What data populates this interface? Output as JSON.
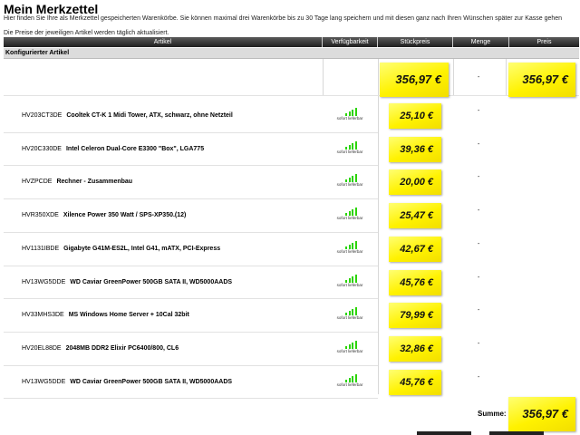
{
  "page": {
    "title": "Mein Merkzettel",
    "intro": "Hier finden Sie Ihre als Merkzettel gespeicherten Warenkörbe. Sie können maximal drei Warenkörbe bis zu 30 Tage lang speichern und mit diesen ganz nach Ihren Wünschen später zur Kasse gehen",
    "price_note": "Die Preise der jeweiligen Artikel werden täglich aktualisiert."
  },
  "table": {
    "headers": [
      "Artikel",
      "Verfügbarkeit",
      "Stückpreis",
      "Menge",
      "Preis"
    ],
    "section_label": "Konfigurierter Artikel",
    "config_unit_price": "356,97 €",
    "config_qty": "-",
    "config_total": "356,97 €",
    "items": [
      {
        "code": "HV203CT3DE",
        "name": "Cooltek CT-K 1 Midi Tower, ATX, schwarz, ohne Netzteil",
        "availability": "sofort lieferbar",
        "unit_price": "25,10 €",
        "qty": "-"
      },
      {
        "code": "HV20C330DE",
        "name": "Intel Celeron Dual-Core E3300 \"Box\", LGA775",
        "availability": "sofort lieferbar",
        "unit_price": "39,36 €",
        "qty": "-"
      },
      {
        "code": "HVZPCDE",
        "name": "Rechner - Zusammenbau",
        "availability": "sofort lieferbar",
        "unit_price": "20,00 €",
        "qty": "-"
      },
      {
        "code": "HVR350XDE",
        "name": "Xilence Power 350 Watt / SPS-XP350.(12)",
        "availability": "sofort lieferbar",
        "unit_price": "25,47 €",
        "qty": "-"
      },
      {
        "code": "HV1131IBDE",
        "name": "Gigabyte G41M-ES2L, Intel G41, mATX, PCI-Express",
        "availability": "sofort lieferbar",
        "unit_price": "42,67 €",
        "qty": "-"
      },
      {
        "code": "HV13WG5DDE",
        "name": "WD Caviar GreenPower 500GB SATA II, WD5000AADS",
        "availability": "sofort lieferbar",
        "unit_price": "45,76 €",
        "qty": "-"
      },
      {
        "code": "HV33MHS3DE",
        "name": "MS Windows Home Server + 10Cal 32bit",
        "availability": "sofort lieferbar",
        "unit_price": "79,99 €",
        "qty": "-"
      },
      {
        "code": "HV20EL88DE",
        "name": "2048MB DDR2 Elixir PC6400/800, CL6",
        "availability": "sofort lieferbar",
        "unit_price": "32,86 €",
        "qty": "-"
      },
      {
        "code": "HV13WG5DDE",
        "name": "WD Caviar GreenPower 500GB SATA II, WD5000AADS",
        "availability": "sofort lieferbar",
        "unit_price": "45,76 €",
        "qty": "-"
      }
    ],
    "sum_label": "Summe:",
    "sum_value": "356,97 €"
  },
  "colors": {
    "sticky_note": "#fff200",
    "availability_bars": "#2bd400",
    "header_bg": "#1f1f1f"
  }
}
